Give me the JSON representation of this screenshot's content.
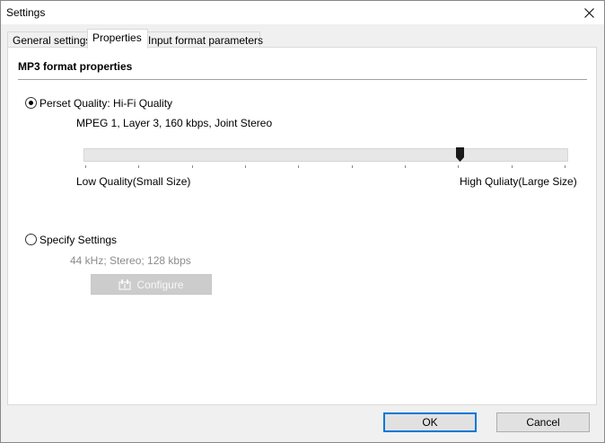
{
  "window": {
    "title": "Settings",
    "close_icon": "close-icon"
  },
  "tabs": [
    {
      "label": "General settings",
      "active": false
    },
    {
      "label": "Properties",
      "active": true
    },
    {
      "label": "Input format parameters",
      "active": false
    }
  ],
  "section": {
    "title": "MP3 format properties"
  },
  "preset": {
    "label": "Perset Quality: Hi-Fi Quality",
    "selected": true,
    "description": "MPEG 1, Layer 3, 160 kbps, Joint Stereo"
  },
  "quality_slider": {
    "min_label": "Low Quality(Small Size)",
    "max_label": "High Quliaty(Large Size)",
    "tick_count": 10,
    "value_fraction": 0.78
  },
  "specify": {
    "label": "Specify Settings",
    "selected": false,
    "description": "44 kHz; Stereo; 128 kbps",
    "configure_label": "Configure",
    "configure_enabled": false
  },
  "buttons": {
    "ok": "OK",
    "cancel": "Cancel"
  },
  "colors": {
    "default_button_border": "#0078d7",
    "panel_background": "#ffffff",
    "dialog_background": "#f0f0f0"
  }
}
